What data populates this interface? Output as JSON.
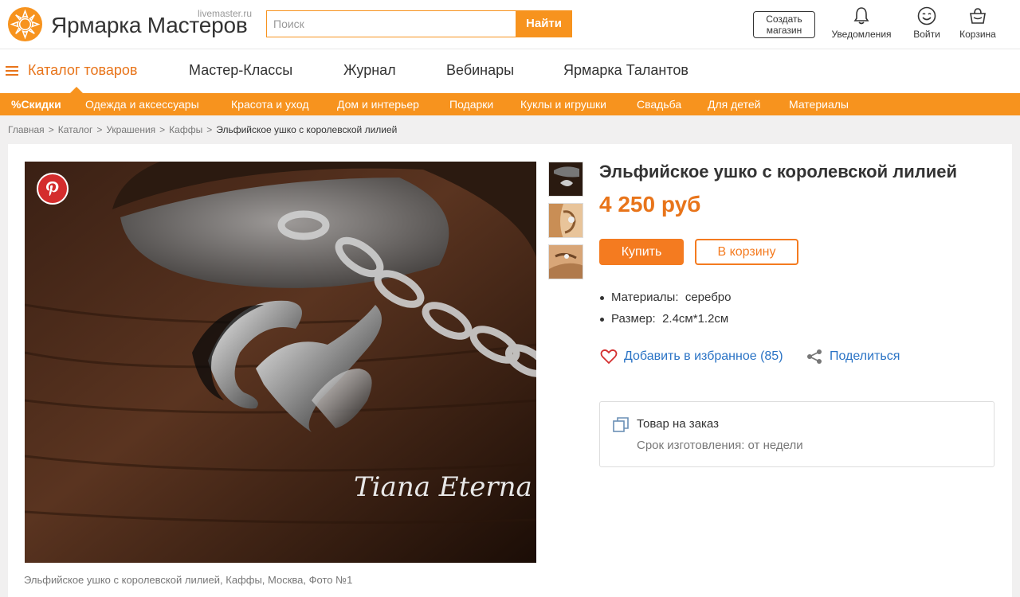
{
  "header": {
    "logo_text": "Ярмарка Мастеров",
    "logo_sub": "livemaster.ru",
    "search_placeholder": "Поиск",
    "search_button": "Найти",
    "create_shop": "Создать магазин",
    "notifications": "Уведомления",
    "login": "Войти",
    "cart": "Корзина",
    "brand_color": "#f7931e"
  },
  "mainnav": {
    "catalog": "Каталог товаров",
    "items": [
      "Мастер-Классы",
      "Журнал",
      "Вебинары",
      "Ярмарка Талантов"
    ]
  },
  "categories": [
    "%Скидки",
    "Одежда и аксессуары",
    "Красота и уход",
    "Дом и интерьер",
    "Подарки",
    "Куклы и игрушки",
    "Свадьба",
    "Для детей",
    "Материалы"
  ],
  "breadcrumb": [
    "Главная",
    "Каталог",
    "Украшения",
    "Каффы",
    "Эльфийское ушко с королевской лилией"
  ],
  "product": {
    "title": "Эльфийское ушко с королевской лилией",
    "price": "4 250 руб",
    "buy": "Купить",
    "to_cart": "В корзину",
    "properties": [
      {
        "label": "Материалы:",
        "value": "серебро"
      },
      {
        "label": "Размер:",
        "value": "2.4см*1.2см"
      }
    ],
    "favorite": "Добавить в избранное (85)",
    "share": "Поделиться",
    "order_title": "Товар на заказ",
    "order_sub": "Срок изготовления: от недели",
    "photo_caption": "Эльфийское ушко с королевской лилией, Каффы, Москва, Фото №1",
    "watermark": "Tiana Eterna"
  }
}
